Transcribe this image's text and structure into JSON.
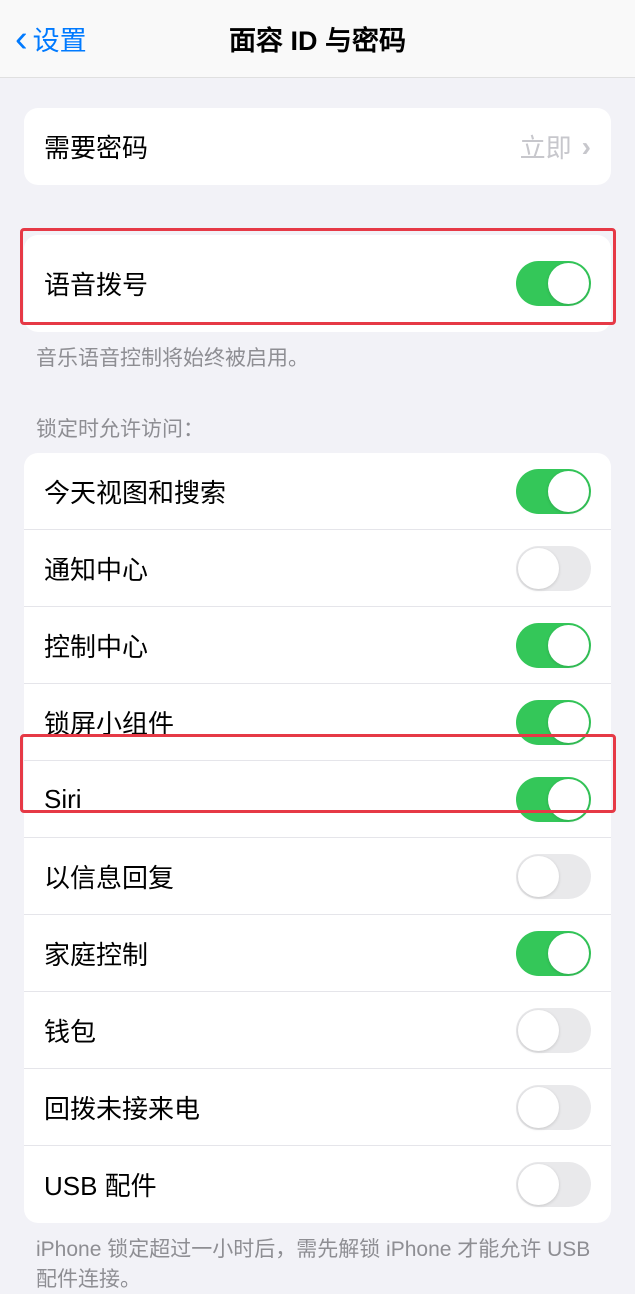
{
  "header": {
    "back_label": "设置",
    "title": "面容 ID 与密码"
  },
  "passcode_row": {
    "label": "需要密码",
    "value": "立即"
  },
  "voice_dial": {
    "label": "语音拨号",
    "on": true,
    "footer": "音乐语音控制将始终被启用。"
  },
  "lock_access": {
    "header": "锁定时允许访问：",
    "items": [
      {
        "label": "今天视图和搜索",
        "on": true
      },
      {
        "label": "通知中心",
        "on": false
      },
      {
        "label": "控制中心",
        "on": true
      },
      {
        "label": "锁屏小组件",
        "on": true
      },
      {
        "label": "Siri",
        "on": true
      },
      {
        "label": "以信息回复",
        "on": false
      },
      {
        "label": "家庭控制",
        "on": true
      },
      {
        "label": "钱包",
        "on": false
      },
      {
        "label": "回拨未接来电",
        "on": false
      },
      {
        "label": "USB 配件",
        "on": false
      }
    ],
    "footer": "iPhone 锁定超过一小时后，需先解锁 iPhone 才能允许 USB 配件连接。"
  }
}
